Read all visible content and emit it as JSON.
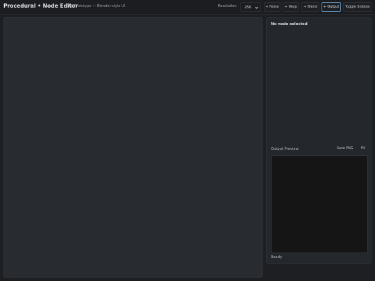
{
  "header": {
    "title": "Procedural • Node Editor",
    "subtitle": "CPU Prototype — Blender-style UI",
    "resolution_label": "Resolution",
    "resolution_value": "256",
    "buttons": {
      "noise": "+ Noise",
      "warp": "+ Warp",
      "blend": "+ Blend",
      "output": "+ Output",
      "toggle_sidebar": "Toggle Sidebar"
    }
  },
  "inspector": {
    "empty_text": "No node selected",
    "output_preview_label": "Output Preview",
    "save_png": "Save PNG",
    "fit": "Fit",
    "status": "Ready"
  },
  "colors": {
    "background": "#1d1f22",
    "canvas": "#282b2f",
    "panel": "#24272b",
    "preview": "#151515",
    "active_outline": "#5f8fb8"
  }
}
